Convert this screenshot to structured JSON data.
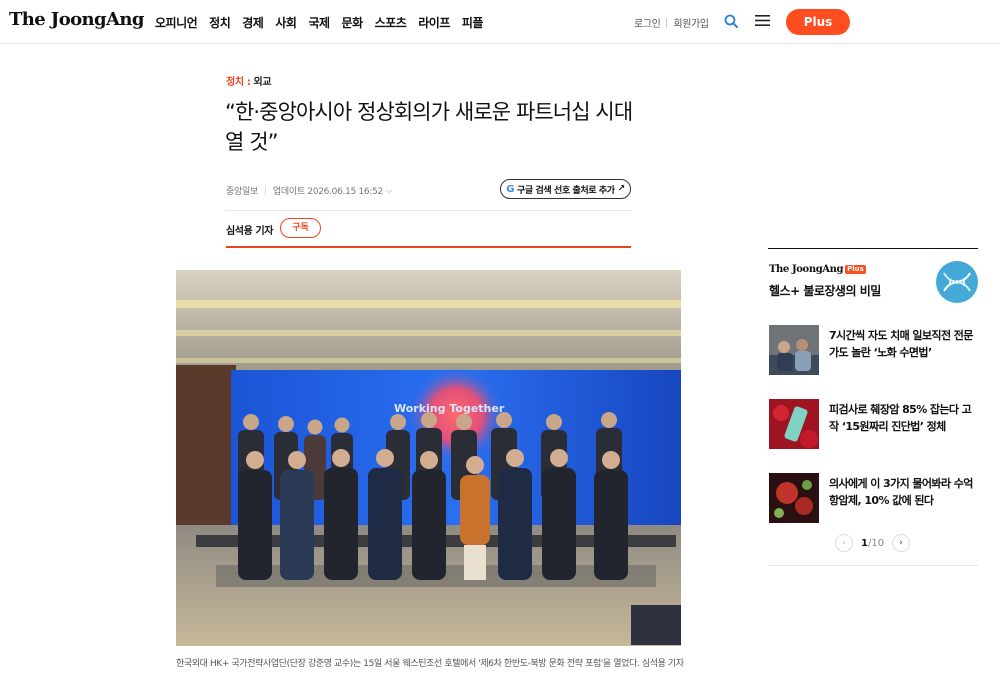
{
  "header": {
    "logo": "The JoongAng",
    "nav": [
      "오피니언",
      "정치",
      "경제",
      "사회",
      "국제",
      "문화",
      "스포츠",
      "라이프",
      "피플"
    ],
    "login": "로그인",
    "signup": "회원가입",
    "plus": "Plus",
    "icons": {
      "search": "search-icon",
      "menu": "menu-icon"
    }
  },
  "article": {
    "section": "정치",
    "subsection": "외교",
    "title": "“한·중앙아시아 정상회의가 새로운 파트너십 시대 열 것”",
    "source": "중앙일보",
    "updated": "업데이트 2026.06.15 16:52",
    "google_button": "구글 검색 선호 출처로 추가",
    "reporter": "심석용 기자",
    "subscribe": "구독",
    "photo_banner_title": "Working Together",
    "caption": "한국외대 HK+ 국가전략사업단(단장 강준영 교수)는 15일 서울 웨스틴조선 호텔에서 '제6차 한반도-북방 문화 전략 포럼'을 열었다. 심석용 기자"
  },
  "rail": {
    "logo": "The JoongAng",
    "logo_badge": "Plus",
    "subtitle": "헬스+ 불로장생의 비밀",
    "items": [
      {
        "title": "7시간씩 자도 치매 일보직전 전문가도 놀란 ‘노화 수면법’"
      },
      {
        "title": "피검사로 췌장암 85% 잡는다 고작 ‘15원짜리 진단법’ 정체"
      },
      {
        "title": "의사에게 이 3가지 물어봐라 수억 항암제, 10% 값에 된다"
      }
    ],
    "page_current": "1",
    "page_total": "/10"
  },
  "colors": {
    "accent": "#e8461c",
    "plus": "#ff4d1f"
  }
}
